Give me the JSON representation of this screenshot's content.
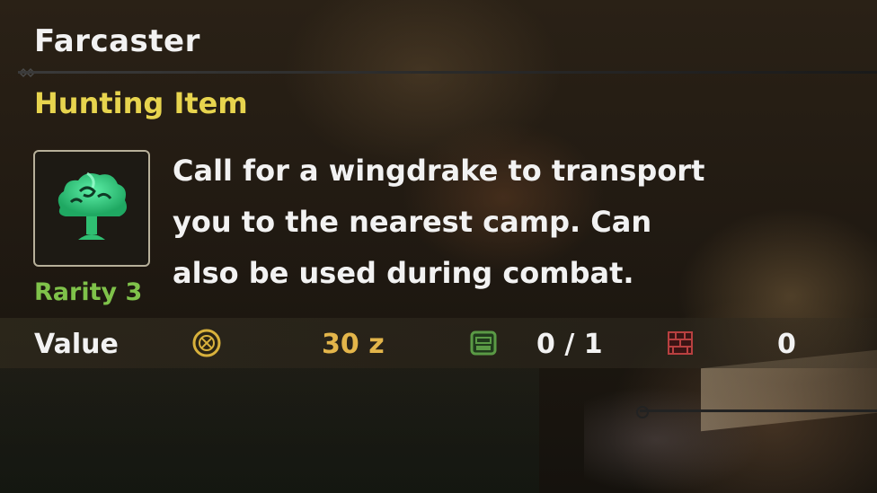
{
  "item": {
    "name": "Farcaster",
    "category": "Hunting Item",
    "rarity": "Rarity 3",
    "description_lines": [
      "Call for a wingdrake to transport",
      "you to the nearest camp. Can",
      "also be used during combat."
    ],
    "icon": "farcaster-item-icon"
  },
  "stats": {
    "value_label": "Value",
    "price": "30 z",
    "owned": "0 / 1",
    "box_count": "0",
    "icons": [
      "zenny-coin-icon",
      "item-pouch-icon",
      "item-box-icon"
    ]
  },
  "colors": {
    "title": "#f2f2f2",
    "category": "#e7d44e",
    "rarity": "#7fc24a",
    "price": "#e3b54a",
    "icon_green": "#33c27a"
  }
}
